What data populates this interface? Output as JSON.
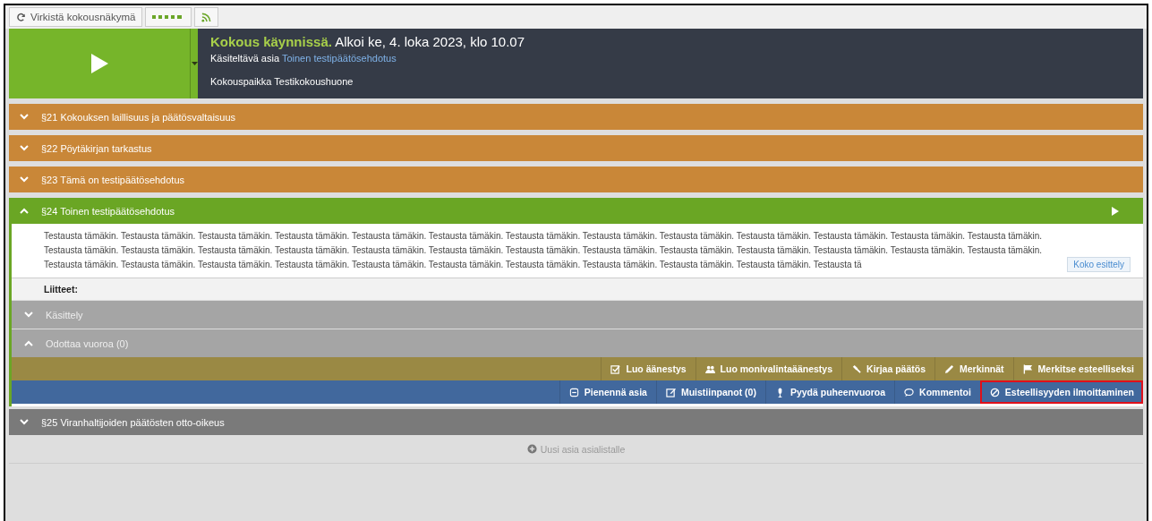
{
  "toolbar": {
    "refresh_button": "Virkistä kokousnäkymä"
  },
  "meeting": {
    "status": "Kokous käynnissä.",
    "started": "Alkoi ke, 4. loka 2023, klo 10.07",
    "current_label": "Käsiteltävä asia",
    "current_item": "Toinen testipäätösehdotus",
    "place": "Kokouspaikka Testikokoushuone"
  },
  "agenda": [
    {
      "title": "§21 Kokouksen laillisuus ja päätösvaltaisuus",
      "color": "#c98738",
      "selected": false,
      "expanded": false
    },
    {
      "title": "§22 Pöytäkirjan tarkastus",
      "color": "#c98738",
      "selected": false,
      "expanded": false
    },
    {
      "title": "§23 Tämä on testipäätösehdotus",
      "color": "#c98738",
      "selected": false,
      "expanded": false
    },
    {
      "title": "§24 Toinen testipäätösehdotus",
      "color": "#6aa624",
      "selected": true,
      "expanded": true,
      "body": "Testausta tämäkin. Testausta tämäkin. Testausta tämäkin. Testausta tämäkin. Testausta tämäkin. Testausta tämäkin. Testausta tämäkin. Testausta tämäkin. Testausta tämäkin. Testausta tämäkin. Testausta tämäkin. Testausta tämäkin. Testausta tämäkin. Testausta tämäkin. Testausta tämäkin. Testausta tämäkin. Testausta tämäkin. Testausta tämäkin. Testausta tämäkin. Testausta tämäkin. Testausta tämäkin. Testausta tämäkin. Testausta tämäkin. Testausta tämäkin. Testausta tämäkin. Testausta tämäkin. Testausta tämäkin. Testausta tämäkin. Testausta tämäkin. Testausta tämäkin. Testausta tämäkin. Testausta tämäkin. Testausta tämäkin. Testausta tämäkin. Testausta tämäkin. Testausta tämäkin. Testausta tä",
      "more_button": "Koko esittely",
      "attachments_label": "Liitteet:",
      "sections": [
        {
          "title": "Käsittely",
          "expanded": false
        },
        {
          "title": "Odottaa vuoroa (0)",
          "expanded": true
        }
      ],
      "chair_actions": [
        {
          "label": "Luo äänestys"
        },
        {
          "label": "Luo monivalintaäänestys"
        },
        {
          "label": "Kirjaa päätös"
        },
        {
          "label": "Merkinnät"
        },
        {
          "label": "Merkitse esteelliseksi"
        }
      ],
      "member_actions": [
        {
          "label": "Pienennä asia",
          "highlighted": false
        },
        {
          "label": "Muistiinpanot  (0)",
          "highlighted": false
        },
        {
          "label": "Pyydä puheenvuoroa",
          "highlighted": false
        },
        {
          "label": "Kommentoi",
          "highlighted": false
        },
        {
          "label": "Esteellisyyden ilmoittaminen",
          "highlighted": true
        }
      ]
    },
    {
      "title": "§25 Viranhaltijoiden päätösten otto-oikeus",
      "color": "#7a7a7a",
      "selected": false,
      "expanded": false
    }
  ],
  "new_item_button": "Uusi asia asialistalle"
}
